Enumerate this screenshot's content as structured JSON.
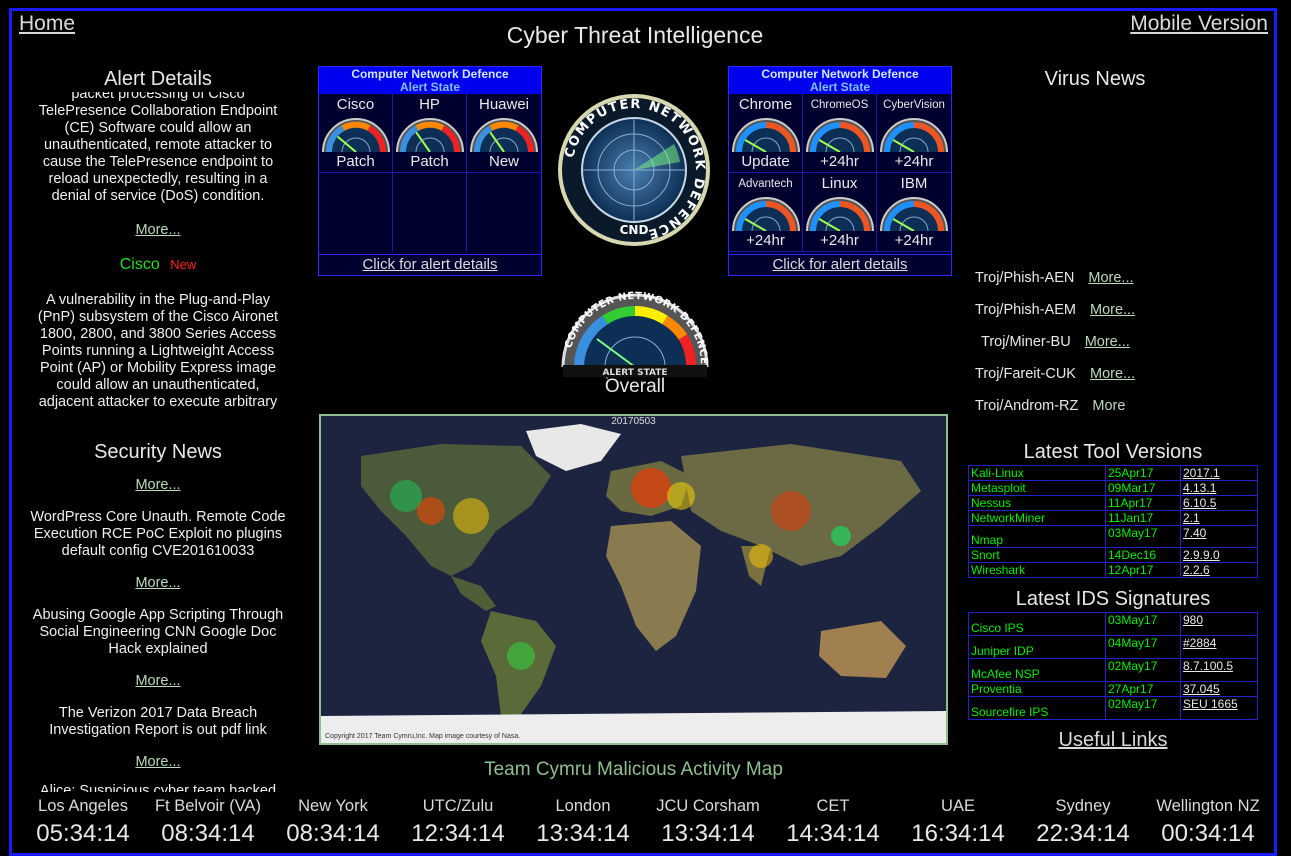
{
  "nav": {
    "home": "Home",
    "mobile": "Mobile Version"
  },
  "title": "Cyber Threat Intelligence",
  "alert_details": {
    "heading": "Alert Details",
    "item1_cut": "packet processing of Cisco",
    "item1": "TelePresence Collaboration Endpoint (CE) Software could allow an unauthenticated, remote attacker to cause the TelePresence endpoint to reload unexpectedly, resulting in a denial of service (DoS) condition.",
    "more": "More...",
    "vendor": "Cisco",
    "badge": "New",
    "item2": "A vulnerability in the Plug-and-Play (PnP) subsystem of the Cisco Aironet 1800, 2800, and 3800 Series Access Points running a Lightweight Access Point (AP) or Mobility Express image could allow an unauthenticated, adjacent attacker to execute arbitrary"
  },
  "panel_title_1": "Computer Network Defence",
  "panel_title_2": "Alert State",
  "panel_left": {
    "cells": [
      {
        "name": "Cisco",
        "status": "Patch"
      },
      {
        "name": "HP",
        "status": "Patch"
      },
      {
        "name": "Huawei",
        "status": "New"
      }
    ],
    "footer": "Click for alert details"
  },
  "panel_right": {
    "cells": [
      {
        "name": "Chrome",
        "status": "Update"
      },
      {
        "name": "ChromeOS",
        "status": "+24hr"
      },
      {
        "name": "CyberVision",
        "status": "+24hr"
      },
      {
        "name": "Advantech",
        "status": "+24hr"
      },
      {
        "name": "Linux",
        "status": "+24hr"
      },
      {
        "name": "IBM",
        "status": "+24hr"
      }
    ],
    "footer": "Click for alert details"
  },
  "cnd_logo": {
    "ring_text": "COMPUTER NETWORK DEFENCE",
    "center": "CND"
  },
  "overall": {
    "ring_text": "COMPUTER NETWORK DEFENCE",
    "state": "ALERT STATE",
    "label": "Overall"
  },
  "virus_news": {
    "heading": "Virus News",
    "items": [
      {
        "name": "Troj/Phish-AEN",
        "more": "More..."
      },
      {
        "name": "Troj/Phish-AEM",
        "more": "More..."
      },
      {
        "name": "Troj/Miner-BU",
        "more": "More..."
      },
      {
        "name": "Troj/Fareit-CUK",
        "more": "More..."
      },
      {
        "name": "Troj/Androm-RZ",
        "more": "More"
      }
    ]
  },
  "security_news": {
    "heading": "Security News",
    "more": "More...",
    "items": [
      "WordPress Core Unauth. Remote Code Execution RCE PoC Exploit no plugins default config CVE201610033",
      "Abusing Google App Scripting Through Social Engineering CNN Google Doc Hack explained",
      "The Verizon 2017 Data Breach Investigation Report is out pdf link"
    ],
    "cut": "Alice: Suspicious cyber team hacked"
  },
  "map": {
    "date": "20170503",
    "copyright": "Copyright 2017 Team Cymru,Inc. Map image courtesy of Nasa.",
    "caption": "Team Cymru Malicious Activity Map"
  },
  "tools": {
    "heading": "Latest Tool Versions",
    "rows": [
      {
        "name": "Kali-Linux",
        "date": "25Apr17",
        "ver": "2017.1"
      },
      {
        "name": "Metasploit",
        "date": "09Mar17",
        "ver": "4.13.1"
      },
      {
        "name": "Nessus",
        "date": "11Apr17",
        "ver": "6.10.5"
      },
      {
        "name": "NetworkMiner",
        "date": "11Jan17",
        "ver": "2.1"
      },
      {
        "name": "Nmap",
        "date": "03May17",
        "ver": "7.40"
      },
      {
        "name": "Snort",
        "date": "14Dec16",
        "ver": "2.9.9.0"
      },
      {
        "name": "Wireshark",
        "date": "12Apr17",
        "ver": "2.2.6"
      }
    ]
  },
  "ids": {
    "heading": "Latest IDS Signatures",
    "rows": [
      {
        "name": "Cisco IPS",
        "date": "03May17",
        "ver": "980"
      },
      {
        "name": "Juniper IDP",
        "date": "04May17",
        "ver": "#2884"
      },
      {
        "name": "McAfee NSP",
        "date": "02May17",
        "ver": "8.7.100.5"
      },
      {
        "name": "Proventia",
        "date": "27Apr17",
        "ver": "37.045"
      },
      {
        "name": "Sourcefire IPS",
        "date": "02May17",
        "ver": "SEU 1665"
      }
    ]
  },
  "useful_links": "Useful Links",
  "clocks": [
    {
      "city": "Los Angeles",
      "time": "05:34:14"
    },
    {
      "city": "Ft Belvoir (VA)",
      "time": "08:34:14"
    },
    {
      "city": "New York",
      "time": "08:34:14"
    },
    {
      "city": "UTC/Zulu",
      "time": "12:34:14"
    },
    {
      "city": "London",
      "time": "13:34:14"
    },
    {
      "city": "JCU Corsham",
      "time": "13:34:14"
    },
    {
      "city": "CET",
      "time": "14:34:14"
    },
    {
      "city": "UAE",
      "time": "16:34:14"
    },
    {
      "city": "Sydney",
      "time": "22:34:14"
    },
    {
      "city": "Wellington NZ",
      "time": "00:34:14"
    }
  ],
  "colors": {
    "frame": "#1a1aff",
    "tool_name": "#00ee00",
    "cisco": "#22dd22",
    "badge_new": "#ff2222",
    "map_caption": "#8fbf8f"
  }
}
